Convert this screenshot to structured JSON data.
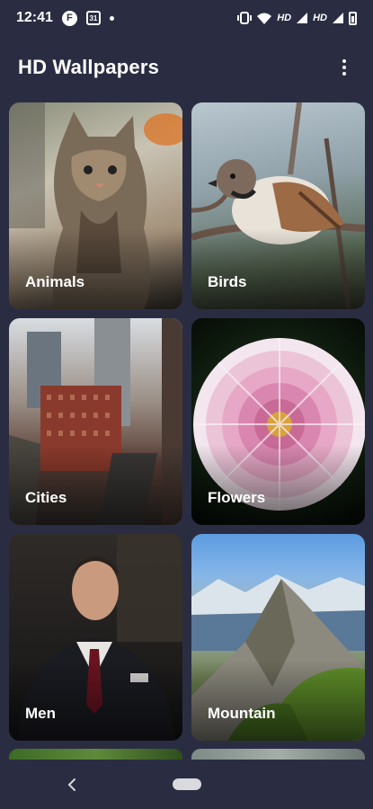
{
  "status_bar": {
    "time": "12:41",
    "badge_letter": "F",
    "calendar_day": "31",
    "hd_1": "HD",
    "hd_2": "HD"
  },
  "app_bar": {
    "title": "HD Wallpapers",
    "menu_icon": "more-vert-icon"
  },
  "categories": [
    {
      "label": "Animals"
    },
    {
      "label": "Birds"
    },
    {
      "label": "Cities"
    },
    {
      "label": "Flowers"
    },
    {
      "label": "Men"
    },
    {
      "label": "Mountain"
    }
  ],
  "nav_bar": {
    "back_icon": "chevron-left-icon",
    "home_icon": "home-pill-icon"
  }
}
